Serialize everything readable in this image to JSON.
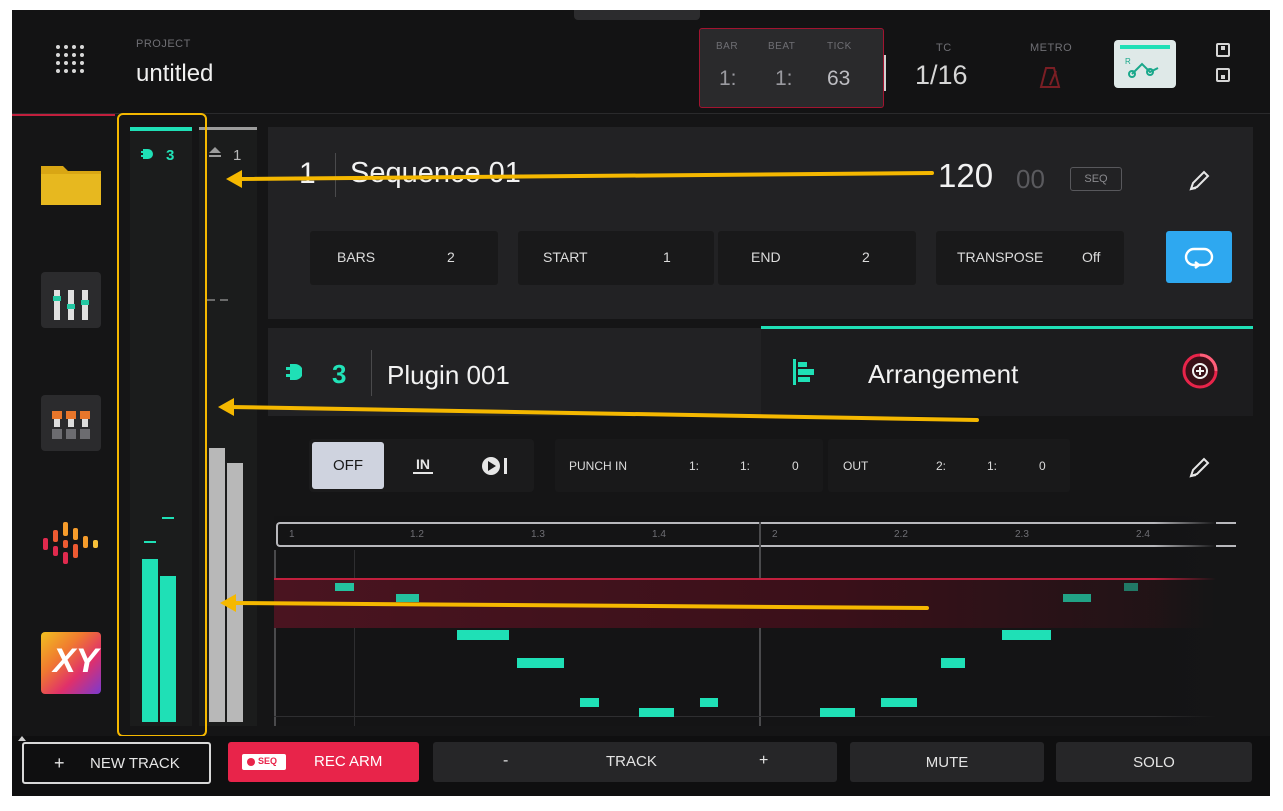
{
  "topbar": {
    "project_label": "PROJECT",
    "project_name": "untitled",
    "bar_label": "BAR",
    "beat_label": "BEAT",
    "tick_label": "TICK",
    "bar_value": "1:",
    "beat_value": "1:",
    "tick_value": "63",
    "tc_label": "TC",
    "tc_value": "1/16",
    "metro_label": "METRO"
  },
  "meters": {
    "track_number": "3",
    "master_number": "1"
  },
  "sequence": {
    "number": "1",
    "name": "Sequence 01",
    "bpm": "120",
    "bpm_decimal": "00",
    "seq_badge": "SEQ",
    "bars_label": "BARS",
    "bars_value": "2",
    "start_label": "START",
    "start_value": "1",
    "end_label": "END",
    "end_value": "2",
    "transpose_label": "TRANSPOSE",
    "transpose_value": "Off"
  },
  "track": {
    "number": "3",
    "name": "Plugin 001",
    "arrangement_label": "Arrangement"
  },
  "record": {
    "off_label": "OFF",
    "in_label": "IN",
    "punch_in_label": "PUNCH IN",
    "punch_in_bar": "1:",
    "punch_in_beat": "1:",
    "punch_in_tick": "0",
    "out_label": "OUT",
    "out_bar": "2:",
    "out_beat": "1:",
    "out_tick": "0"
  },
  "ruler": {
    "labels": [
      "1",
      "1.2",
      "1.3",
      "1.4",
      "2",
      "2.2",
      "2.3",
      "2.4"
    ]
  },
  "bottombar": {
    "new_track_label": "NEW TRACK",
    "seq_badge": "SEQ",
    "rec_arm_label": "REC ARM",
    "minus_label": "-",
    "track_label": "TRACK",
    "plus_label": "+",
    "mute_label": "MUTE",
    "solo_label": "SOLO"
  },
  "colors": {
    "accent_teal": "#1fe0b6",
    "highlight_yellow": "#f5b800",
    "rec_red": "#e8244a",
    "loop_blue": "#2ea8f0"
  }
}
